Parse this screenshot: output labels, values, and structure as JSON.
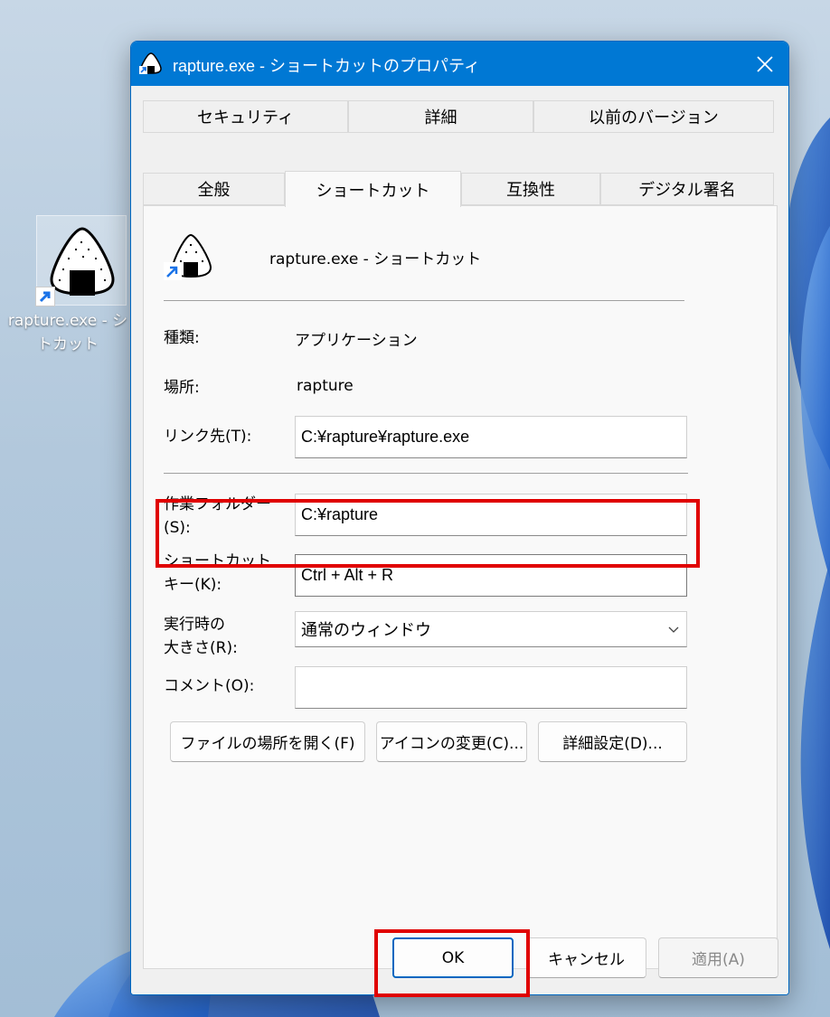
{
  "desktop": {
    "icon_label_line1": "rapture.exe - シ",
    "icon_label_line2": "トカット"
  },
  "dialog": {
    "title": "rapture.exe - ショートカットのプロパティ",
    "close_icon": "close-icon"
  },
  "tabs": {
    "row1": [
      "セキュリティ",
      "詳細",
      "以前のバージョン"
    ],
    "row2": [
      "全般",
      "ショートカット",
      "互換性",
      "デジタル署名"
    ],
    "active": "ショートカット"
  },
  "shortcut": {
    "name": "rapture.exe - ショートカット",
    "type_label": "種類:",
    "type_value": "アプリケーション",
    "location_label": "場所:",
    "location_value": "rapture",
    "target_label": "リンク先(T):",
    "target_value": "C:¥rapture¥rapture.exe",
    "start_in_label_1": "作業フォルダー",
    "start_in_label_2": "(S):",
    "start_in_value": "C:¥rapture",
    "hotkey_label_1": "ショートカット",
    "hotkey_label_2": "キー(K):",
    "hotkey_value": "Ctrl + Alt + R",
    "run_label_1": "実行時の",
    "run_label_2": "大きさ(R):",
    "run_value": "通常のウィンドウ",
    "comment_label": "コメント(O):",
    "comment_value": ""
  },
  "buttons": {
    "open_location": "ファイルの場所を開く(F)",
    "change_icon": "アイコンの変更(C)...",
    "advanced": "詳細設定(D)...",
    "ok": "OK",
    "cancel": "キャンセル",
    "apply": "適用(A)"
  },
  "colors": {
    "titlebar": "#0078d4",
    "highlight": "#e00000",
    "primary_border": "#0067c0"
  }
}
